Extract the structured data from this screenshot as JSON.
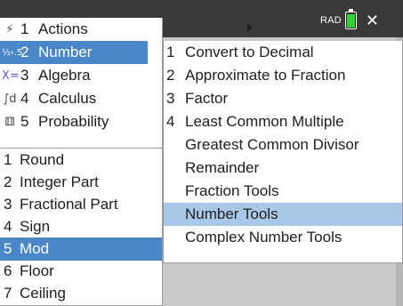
{
  "status": {
    "angle_mode": "RAD",
    "close_glyph": "✕"
  },
  "menu": {
    "items": [
      {
        "num": "1",
        "label": "Actions",
        "icon": "lightning-icon",
        "glyph": "⚡"
      },
      {
        "num": "2",
        "label": "Number",
        "icon": "fraction-decimal-icon",
        "glyph": "½›.5"
      },
      {
        "num": "3",
        "label": "Algebra",
        "icon": "x-equals-icon",
        "glyph": "X="
      },
      {
        "num": "4",
        "label": "Calculus",
        "icon": "integral-icon",
        "glyph": "∫d"
      },
      {
        "num": "5",
        "label": "Probability",
        "icon": "dice-icon",
        "glyph": "⚅"
      }
    ],
    "selected_index": 1
  },
  "number_submenu": {
    "items": [
      {
        "num": "1",
        "label": "Convert to Decimal"
      },
      {
        "num": "2",
        "label": "Approximate to Fraction"
      },
      {
        "num": "3",
        "label": "Factor"
      },
      {
        "num": "4",
        "label": "Least Common Multiple"
      },
      {
        "num": "",
        "label": "Greatest Common Divisor"
      },
      {
        "num": "",
        "label": "Remainder"
      },
      {
        "num": "",
        "label": "Fraction Tools"
      },
      {
        "num": "",
        "label": "Number Tools"
      },
      {
        "num": "",
        "label": "Complex Number Tools"
      }
    ],
    "highlighted_index": 7
  },
  "number_tools_submenu": {
    "items": [
      {
        "num": "1",
        "label": "Round"
      },
      {
        "num": "2",
        "label": "Integer Part"
      },
      {
        "num": "3",
        "label": "Fractional Part"
      },
      {
        "num": "4",
        "label": "Sign"
      },
      {
        "num": "5",
        "label": "Mod"
      },
      {
        "num": "6",
        "label": "Floor"
      },
      {
        "num": "7",
        "label": "Ceiling"
      }
    ],
    "selected_index": 4
  },
  "colors": {
    "selection": "#4a87c9",
    "hover_highlight": "#a9c8e8",
    "topbar": "#3a3a3a",
    "battery": "#35d035"
  }
}
